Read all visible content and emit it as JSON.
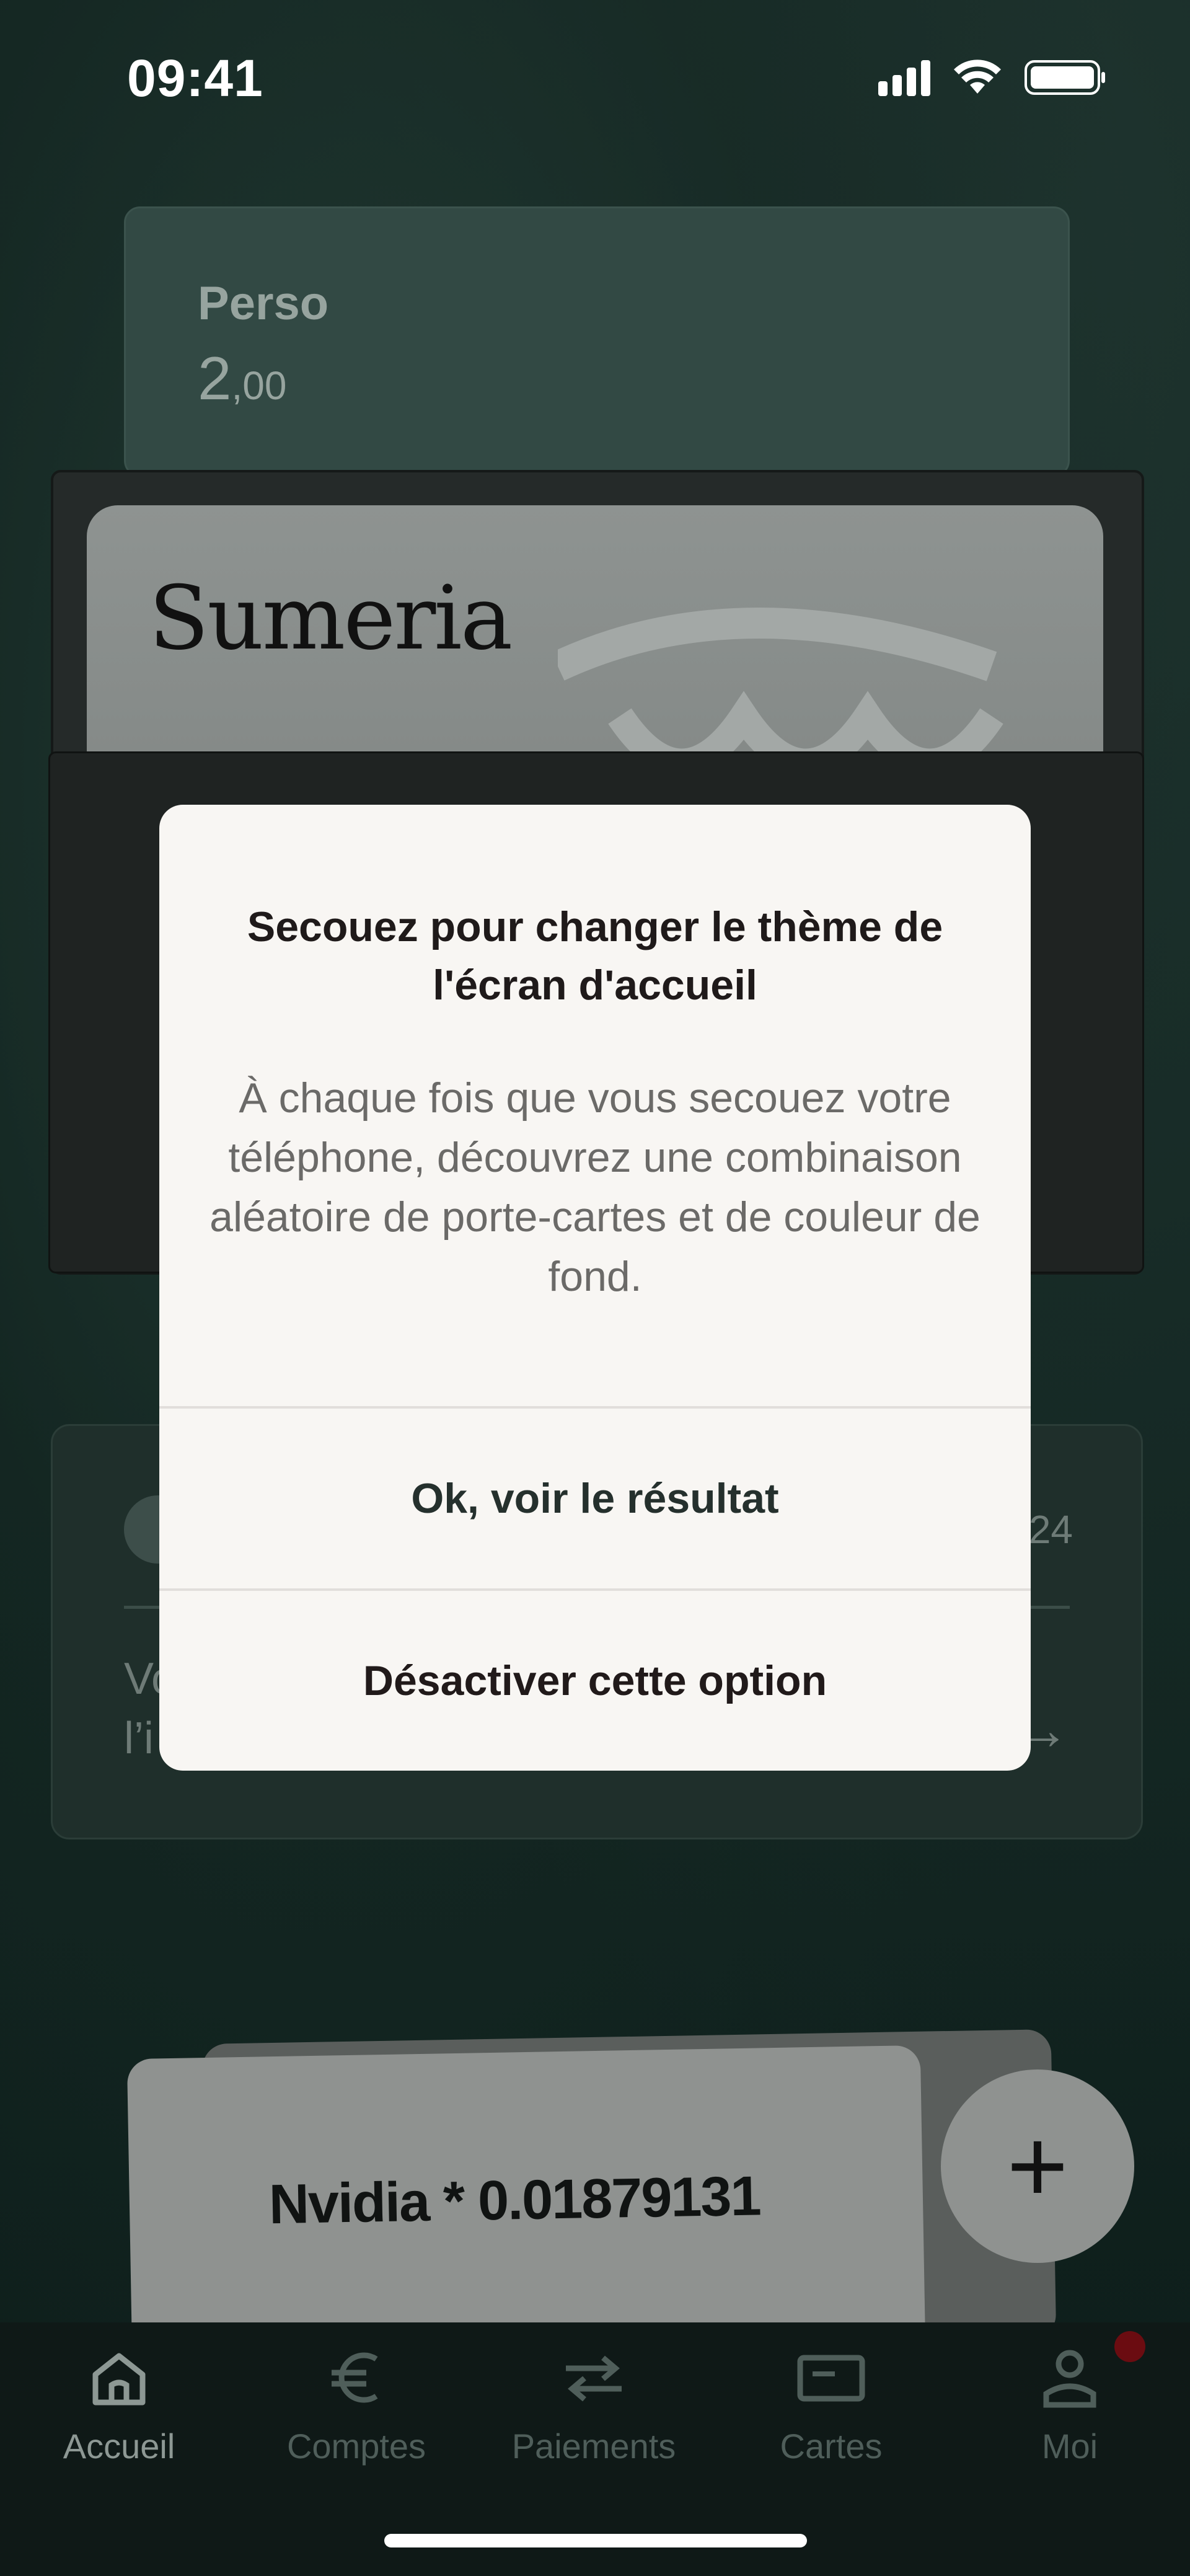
{
  "status_bar": {
    "time": "09:41"
  },
  "account_card": {
    "label": "Perso",
    "amount_main": "2",
    "amount_decimals": ",00"
  },
  "wallet": {
    "brand": "Sumeria"
  },
  "info_card": {
    "date_fragment": "24",
    "text_line1": "Vo",
    "text_line2": "l’i"
  },
  "asset_card": {
    "text": "Nvidia * 0.01879131"
  },
  "modal": {
    "title": "Secouez pour changer le thème de l'écran d'accueil",
    "body": "À chaque fois que vous secouez votre téléphone, découvrez une combinaison aléatoire de porte-cartes et de couleur de fond.",
    "primary_button": "Ok, voir le résultat",
    "secondary_button": "Désactiver cette option"
  },
  "tabs": [
    {
      "label": "Accueil",
      "icon": "home-icon",
      "active": true
    },
    {
      "label": "Comptes",
      "icon": "euro-icon",
      "active": false
    },
    {
      "label": "Paiements",
      "icon": "transfer-arrows-icon",
      "active": false
    },
    {
      "label": "Cartes",
      "icon": "card-icon",
      "active": false
    },
    {
      "label": "Moi",
      "icon": "profile-icon",
      "active": false
    }
  ],
  "colors": {
    "background": "#142622",
    "modal_background": "#f8f6f3",
    "primary_button_text": "#25302d",
    "secondary_button_text": "#211a1a",
    "notification_badge": "#6b0c11"
  }
}
